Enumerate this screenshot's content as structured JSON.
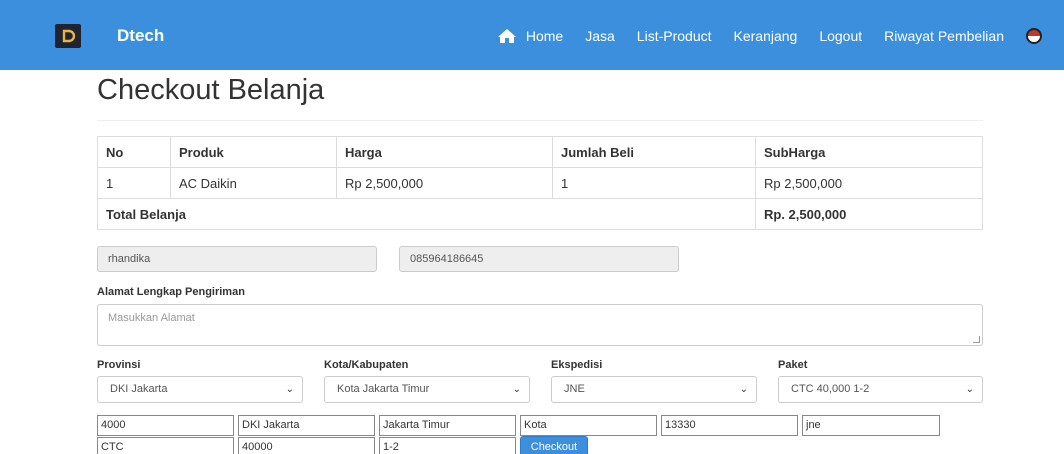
{
  "navbar": {
    "brand": "Dtech",
    "logo_text": "DTECH",
    "links": {
      "home": "Home",
      "jasa": "Jasa",
      "list_product": "List-Product",
      "keranjang": "Keranjang",
      "logout": "Logout",
      "riwayat": "Riwayat Pembelian"
    },
    "icons": {
      "home": "home-icon",
      "avatar": "user-avatar-icon"
    }
  },
  "page": {
    "title": "Checkout Belanja"
  },
  "cart": {
    "headers": [
      "No",
      "Produk",
      "Harga",
      "Jumlah Beli",
      "SubHarga"
    ],
    "rows": [
      [
        "1",
        "AC Daikin",
        "Rp 2,500,000",
        "1",
        "Rp 2,500,000"
      ]
    ],
    "total_label": "Total Belanja",
    "total_value": "Rp. 2,500,000"
  },
  "customer": {
    "name": "rhandika",
    "phone": "085964186645"
  },
  "address": {
    "label": "Alamat Lengkap Pengiriman",
    "placeholder": "Masukkan Alamat"
  },
  "shipping": {
    "provinsi": {
      "label": "Provinsi",
      "value": "DKI Jakarta"
    },
    "kota": {
      "label": "Kota/Kabupaten",
      "value": "Kota Jakarta Timur"
    },
    "ekspedisi": {
      "label": "Ekspedisi",
      "value": "JNE"
    },
    "paket": {
      "label": "Paket",
      "value": "CTC 40,000 1-2"
    }
  },
  "hidden_fields": {
    "row1": [
      "4000",
      "DKI Jakarta",
      "Jakarta Timur",
      "Kota",
      "13330",
      "jne"
    ],
    "row2": [
      "CTC",
      "40000",
      "1-2"
    ]
  },
  "checkout_button": "Checkout",
  "colors": {
    "navbar": "#3b8fdc",
    "button": "#3b8fdc"
  }
}
